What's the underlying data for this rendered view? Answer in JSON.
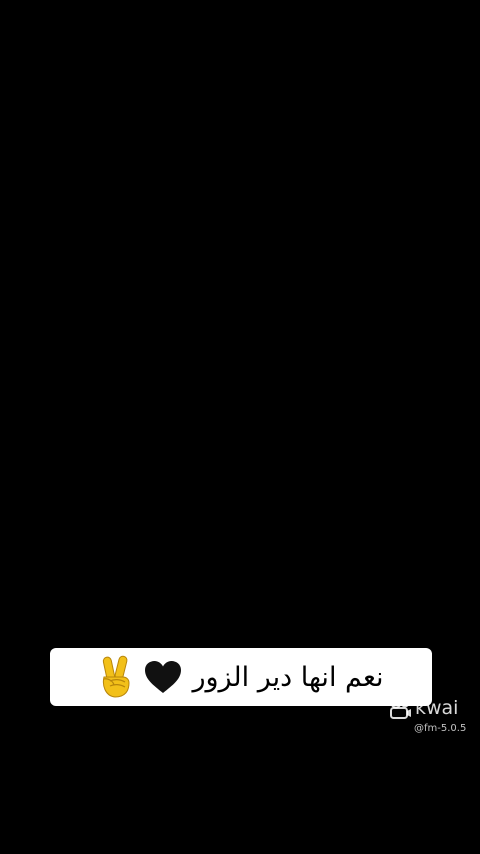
{
  "caption": {
    "text": "نعم انها دير الزور",
    "emojis": [
      "black-heart-icon",
      "victory-hand-icon"
    ]
  },
  "watermark": {
    "brand": "kwai",
    "handle": "@fm-5.0.5"
  },
  "colors": {
    "background": "#000000",
    "pill": "#ffffff",
    "heart": "#111111",
    "hand": "#f2c019"
  }
}
